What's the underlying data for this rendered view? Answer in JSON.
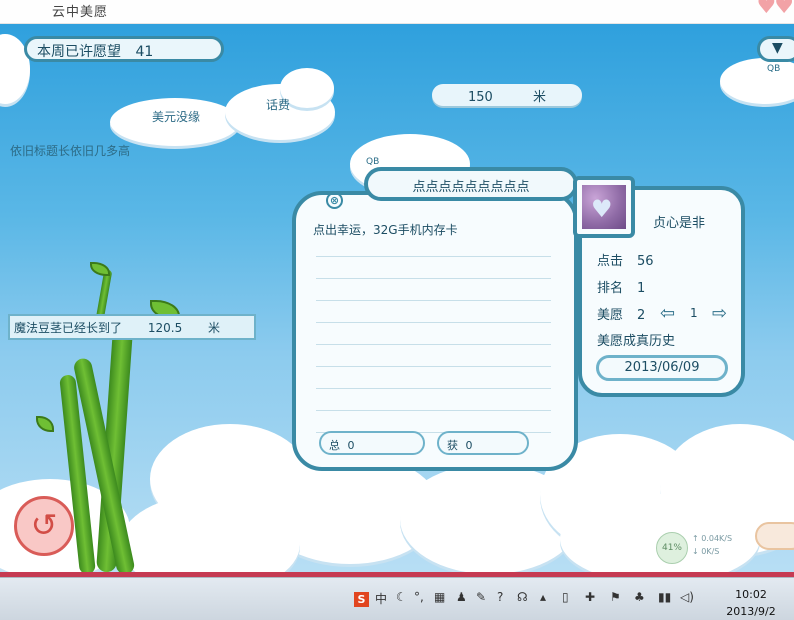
{
  "window": {
    "title": "云中美愿",
    "hearts": "♥♥"
  },
  "header": {
    "weekly_label": "本周已许愿望",
    "weekly_count": "41",
    "dropdown_icon": "▼",
    "qb_top": "QB",
    "distance_value": "150",
    "distance_unit": "米"
  },
  "floating_clouds": {
    "label_1": "美元没缘",
    "label_2": "话费",
    "scroll_text": "依旧标题长依旧几多高",
    "qb_mid": "QB"
  },
  "beanstalk": {
    "label": "魔法豆茎已经长到了",
    "height": "120.5",
    "unit": "米"
  },
  "wish_card": {
    "title": "点点点点点点点点点",
    "close_icon": "⊗",
    "text": "点出幸运，32G手机内存卡",
    "total_label": "总",
    "total_value": "0",
    "won_label": "获",
    "won_value": "0"
  },
  "profile": {
    "user_name": "贞心是非",
    "clicks_label": "点击",
    "clicks_value": "56",
    "rank_label": "排名",
    "rank_value": "1",
    "wish_label": "美愿",
    "wish_value": "2",
    "prev_icon": "⇦",
    "page": "1",
    "next_icon": "⇨",
    "history_link": "美愿成真历史",
    "date": "2013/06/09"
  },
  "controls": {
    "back_icon": "↺",
    "net_percent": "41%",
    "net_up": "↑ 0.04K/S",
    "net_down": "↓ 0K/S"
  },
  "taskbar": {
    "tray_icons": [
      "S",
      "中",
      "☾",
      "°,",
      "▦",
      "♟",
      "✎",
      "?",
      "☊",
      "▴",
      "▯",
      "✚",
      "⚑",
      "♣",
      "▮▮",
      "◁)"
    ],
    "time": "10:02",
    "date": "2013/9/2"
  }
}
